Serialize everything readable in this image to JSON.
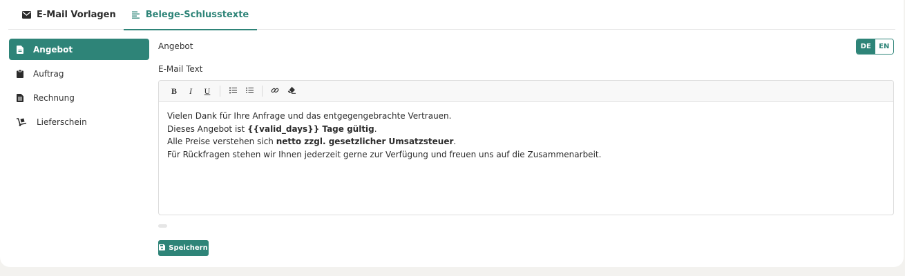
{
  "tabs": [
    {
      "label": "E-Mail Vorlagen",
      "icon": "envelope-icon",
      "active": false
    },
    {
      "label": "Belege-Schlusstexte",
      "icon": "align-left-icon",
      "active": true
    }
  ],
  "sidebar": {
    "items": [
      {
        "label": "Angebot",
        "icon": "document-icon",
        "active": true
      },
      {
        "label": "Auftrag",
        "icon": "clipboard-icon",
        "active": false
      },
      {
        "label": "Rechnung",
        "icon": "invoice-icon",
        "active": false
      },
      {
        "label": "Lieferschein",
        "icon": "dolly-icon",
        "active": false
      }
    ]
  },
  "main": {
    "heading": "Angebot",
    "languages": [
      {
        "label": "DE",
        "active": true
      },
      {
        "label": "EN",
        "active": false
      }
    ],
    "field_label": "E-Mail Text",
    "editor": {
      "toolbar": {
        "bold": "B",
        "italic": "I",
        "underline": "U"
      },
      "lines": {
        "l1": "Vielen Dank für Ihre Anfrage und das entgegengebrachte Vertrauen.",
        "l2_pre": "Dieses Angebot ist ",
        "l2_bold": "{{valid_days}} Tage gültig",
        "l2_post": ".",
        "l3_pre": "Alle Preise verstehen sich ",
        "l3_bold": "netto zzgl. gesetzlicher Umsatzsteuer",
        "l3_post": ".",
        "l4": "Für Rückfragen stehen wir Ihnen jederzeit gerne zur Verfügung und freuen uns auf die Zusammenarbeit."
      }
    },
    "save_label": "Speichern"
  },
  "colors": {
    "accent": "#2e8478",
    "background": "#f3f2ef",
    "card": "#ffffff"
  }
}
